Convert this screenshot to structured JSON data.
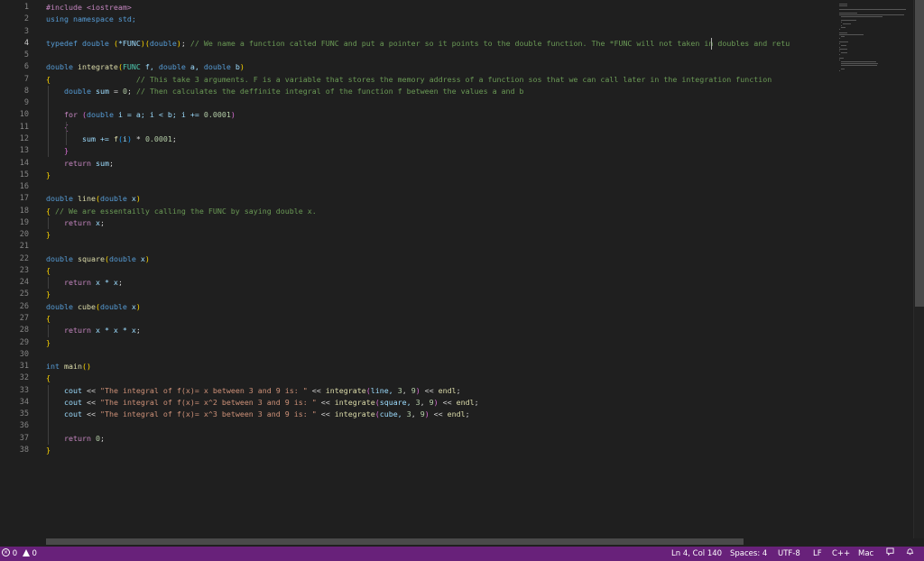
{
  "editor": {
    "active_line": 4,
    "lines": [
      {
        "n": "1",
        "segments": [
          {
            "t": "#include <iostream>",
            "c": "p"
          }
        ]
      },
      {
        "n": "2",
        "segments": [
          {
            "t": "using namespace std;",
            "c": "k"
          }
        ]
      },
      {
        "n": "3",
        "segments": []
      },
      {
        "n": "4",
        "segments": [
          {
            "t": "typedef double ",
            "c": "k"
          },
          {
            "t": "(",
            "c": "b1"
          },
          {
            "t": "*FUNC",
            "c": "v"
          },
          {
            "t": ")",
            "c": "b1"
          },
          {
            "t": "(",
            "c": "b1"
          },
          {
            "t": "double",
            "c": "k"
          },
          {
            "t": ")",
            "c": "b1"
          },
          {
            "t": "; ",
            "c": "d"
          },
          {
            "t": "// We name a function called FUNC and put a pointer so it points to the double function. The *FUNC will not taken in doubles and retu",
            "c": "c"
          }
        ]
      },
      {
        "n": "5",
        "segments": []
      },
      {
        "n": "6",
        "segments": [
          {
            "t": "double ",
            "c": "k"
          },
          {
            "t": "integrate",
            "c": "fn"
          },
          {
            "t": "(",
            "c": "b1"
          },
          {
            "t": "FUNC ",
            "c": "ty"
          },
          {
            "t": "f, ",
            "c": "v"
          },
          {
            "t": "double ",
            "c": "k"
          },
          {
            "t": "a, ",
            "c": "v"
          },
          {
            "t": "double ",
            "c": "k"
          },
          {
            "t": "b",
            "c": "v"
          },
          {
            "t": ")",
            "c": "b1"
          }
        ]
      },
      {
        "n": "7",
        "segments": [
          {
            "t": "{",
            "c": "b1"
          },
          {
            "t": "                   // This take 3 arguments. F is a variable that stores the memory address of a function sos that we can call later in the integration function",
            "c": "c"
          }
        ]
      },
      {
        "n": "8",
        "segments": [
          {
            "t": "    double ",
            "c": "k"
          },
          {
            "t": "sum",
            "c": "v"
          },
          {
            "t": " = ",
            "c": "d"
          },
          {
            "t": "0",
            "c": "n"
          },
          {
            "t": "; ",
            "c": "d"
          },
          {
            "t": "// Then calculates the deffinite integral of the function f between the values a and b",
            "c": "c"
          }
        ]
      },
      {
        "n": "9",
        "segments": []
      },
      {
        "n": "10",
        "segments": [
          {
            "t": "    for ",
            "c": "p"
          },
          {
            "t": "(",
            "c": "b2"
          },
          {
            "t": "double ",
            "c": "k"
          },
          {
            "t": "i = a; i < b; i += ",
            "c": "v"
          },
          {
            "t": "0.0001",
            "c": "n"
          },
          {
            "t": ")",
            "c": "b2"
          }
        ]
      },
      {
        "n": "11",
        "segments": [
          {
            "t": "    {",
            "c": "b2"
          }
        ]
      },
      {
        "n": "12",
        "segments": [
          {
            "t": "        sum += ",
            "c": "v"
          },
          {
            "t": "f",
            "c": "fn"
          },
          {
            "t": "(",
            "c": "b3"
          },
          {
            "t": "i",
            "c": "v"
          },
          {
            "t": ")",
            "c": "b3"
          },
          {
            "t": " * ",
            "c": "d"
          },
          {
            "t": "0.0001",
            "c": "n"
          },
          {
            "t": ";",
            "c": "d"
          }
        ]
      },
      {
        "n": "13",
        "segments": [
          {
            "t": "    }",
            "c": "b2"
          }
        ]
      },
      {
        "n": "14",
        "segments": [
          {
            "t": "    return ",
            "c": "p"
          },
          {
            "t": "sum",
            "c": "v"
          },
          {
            "t": ";",
            "c": "d"
          }
        ]
      },
      {
        "n": "15",
        "segments": [
          {
            "t": "}",
            "c": "b1"
          }
        ]
      },
      {
        "n": "16",
        "segments": []
      },
      {
        "n": "17",
        "segments": [
          {
            "t": "double ",
            "c": "k"
          },
          {
            "t": "line",
            "c": "fn"
          },
          {
            "t": "(",
            "c": "b1"
          },
          {
            "t": "double ",
            "c": "k"
          },
          {
            "t": "x",
            "c": "v"
          },
          {
            "t": ")",
            "c": "b1"
          }
        ]
      },
      {
        "n": "18",
        "segments": [
          {
            "t": "{ ",
            "c": "b1"
          },
          {
            "t": "// We are essentailly calling the FUNC by saying double x.",
            "c": "c"
          }
        ]
      },
      {
        "n": "19",
        "segments": [
          {
            "t": "    return ",
            "c": "p"
          },
          {
            "t": "x",
            "c": "v"
          },
          {
            "t": ";",
            "c": "d"
          }
        ]
      },
      {
        "n": "20",
        "segments": [
          {
            "t": "}",
            "c": "b1"
          }
        ]
      },
      {
        "n": "21",
        "segments": []
      },
      {
        "n": "22",
        "segments": [
          {
            "t": "double ",
            "c": "k"
          },
          {
            "t": "square",
            "c": "fn"
          },
          {
            "t": "(",
            "c": "b1"
          },
          {
            "t": "double ",
            "c": "k"
          },
          {
            "t": "x",
            "c": "v"
          },
          {
            "t": ")",
            "c": "b1"
          }
        ]
      },
      {
        "n": "23",
        "segments": [
          {
            "t": "{",
            "c": "b1"
          }
        ]
      },
      {
        "n": "24",
        "segments": [
          {
            "t": "    return ",
            "c": "p"
          },
          {
            "t": "x * x",
            "c": "v"
          },
          {
            "t": ";",
            "c": "d"
          }
        ]
      },
      {
        "n": "25",
        "segments": [
          {
            "t": "}",
            "c": "b1"
          }
        ]
      },
      {
        "n": "26",
        "segments": [
          {
            "t": "double ",
            "c": "k"
          },
          {
            "t": "cube",
            "c": "fn"
          },
          {
            "t": "(",
            "c": "b1"
          },
          {
            "t": "double ",
            "c": "k"
          },
          {
            "t": "x",
            "c": "v"
          },
          {
            "t": ")",
            "c": "b1"
          }
        ]
      },
      {
        "n": "27",
        "segments": [
          {
            "t": "{",
            "c": "b1"
          }
        ]
      },
      {
        "n": "28",
        "segments": [
          {
            "t": "    return ",
            "c": "p"
          },
          {
            "t": "x * x * x",
            "c": "v"
          },
          {
            "t": ";",
            "c": "d"
          }
        ]
      },
      {
        "n": "29",
        "segments": [
          {
            "t": "}",
            "c": "b1"
          }
        ]
      },
      {
        "n": "30",
        "segments": []
      },
      {
        "n": "31",
        "segments": [
          {
            "t": "int ",
            "c": "k"
          },
          {
            "t": "main",
            "c": "fn"
          },
          {
            "t": "()",
            "c": "b1"
          }
        ]
      },
      {
        "n": "32",
        "segments": [
          {
            "t": "{",
            "c": "b1"
          }
        ]
      },
      {
        "n": "33",
        "segments": [
          {
            "t": "    cout ",
            "c": "v"
          },
          {
            "t": "<< ",
            "c": "d"
          },
          {
            "t": "\"The integral of f(x)= x between 3 and 9 is: \"",
            "c": "s"
          },
          {
            "t": " << ",
            "c": "d"
          },
          {
            "t": "integrate",
            "c": "fn"
          },
          {
            "t": "(",
            "c": "b2"
          },
          {
            "t": "line, ",
            "c": "v"
          },
          {
            "t": "3",
            "c": "n"
          },
          {
            "t": ", ",
            "c": "d"
          },
          {
            "t": "9",
            "c": "n"
          },
          {
            "t": ")",
            "c": "b2"
          },
          {
            "t": " << ",
            "c": "d"
          },
          {
            "t": "endl",
            "c": "fn"
          },
          {
            "t": ";",
            "c": "d"
          }
        ]
      },
      {
        "n": "34",
        "segments": [
          {
            "t": "    cout ",
            "c": "v"
          },
          {
            "t": "<< ",
            "c": "d"
          },
          {
            "t": "\"The integral of f(x)= x^2 between 3 and 9 is: \"",
            "c": "s"
          },
          {
            "t": " << ",
            "c": "d"
          },
          {
            "t": "integrate",
            "c": "fn"
          },
          {
            "t": "(",
            "c": "b2"
          },
          {
            "t": "square, ",
            "c": "v"
          },
          {
            "t": "3",
            "c": "n"
          },
          {
            "t": ", ",
            "c": "d"
          },
          {
            "t": "9",
            "c": "n"
          },
          {
            "t": ")",
            "c": "b2"
          },
          {
            "t": " << ",
            "c": "d"
          },
          {
            "t": "endl",
            "c": "fn"
          },
          {
            "t": ";",
            "c": "d"
          }
        ]
      },
      {
        "n": "35",
        "segments": [
          {
            "t": "    cout ",
            "c": "v"
          },
          {
            "t": "<< ",
            "c": "d"
          },
          {
            "t": "\"The integral of f(x)= x^3 between 3 and 9 is: \"",
            "c": "s"
          },
          {
            "t": " << ",
            "c": "d"
          },
          {
            "t": "integrate",
            "c": "fn"
          },
          {
            "t": "(",
            "c": "b2"
          },
          {
            "t": "cube, ",
            "c": "v"
          },
          {
            "t": "3",
            "c": "n"
          },
          {
            "t": ", ",
            "c": "d"
          },
          {
            "t": "9",
            "c": "n"
          },
          {
            "t": ")",
            "c": "b2"
          },
          {
            "t": " << ",
            "c": "d"
          },
          {
            "t": "endl",
            "c": "fn"
          },
          {
            "t": ";",
            "c": "d"
          }
        ]
      },
      {
        "n": "36",
        "segments": []
      },
      {
        "n": "37",
        "segments": [
          {
            "t": "    return ",
            "c": "p"
          },
          {
            "t": "0",
            "c": "n"
          },
          {
            "t": ";",
            "c": "d"
          }
        ]
      },
      {
        "n": "38",
        "segments": [
          {
            "t": "}",
            "c": "b1"
          }
        ]
      }
    ]
  },
  "statusbar": {
    "errors_icon": "error-circle-icon",
    "errors": "0",
    "warnings_icon": "warning-triangle-icon",
    "warnings": "0",
    "cursor": "Ln 4, Col 140",
    "indent": "Spaces: 4",
    "encoding": "UTF-8",
    "eol": "LF",
    "language": "C++",
    "platform": "Mac",
    "feedback_icon": "feedback-icon",
    "bell_icon": "notifications-bell-icon"
  },
  "colors": {
    "editor_bg": "#1f1f1f",
    "statusbar_bg": "#68217a",
    "keyword": "#569cd6",
    "comment": "#6a9955",
    "string": "#ce9178",
    "number": "#b5cea8",
    "function": "#dcdcaa"
  }
}
